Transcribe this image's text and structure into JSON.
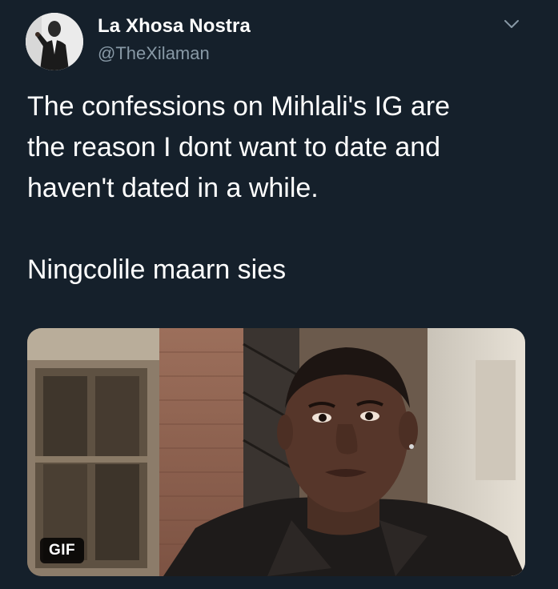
{
  "tweet": {
    "author": {
      "display_name": "La Xhosa Nostra",
      "handle": "@TheXilaman",
      "avatar_icon": "profile-photo"
    },
    "menu_icon": "chevron-down-icon",
    "text_lines": [
      "The confessions on Mihlali's IG are",
      "the reason I dont want to date and",
      "haven't dated in a while."
    ],
    "text_second_paragraph": "Ningcolile maarn sies",
    "media": {
      "type": "gif",
      "badge": "GIF"
    }
  },
  "colors": {
    "background": "#15202b",
    "text": "#ffffff",
    "secondary_text": "#8899a6"
  }
}
